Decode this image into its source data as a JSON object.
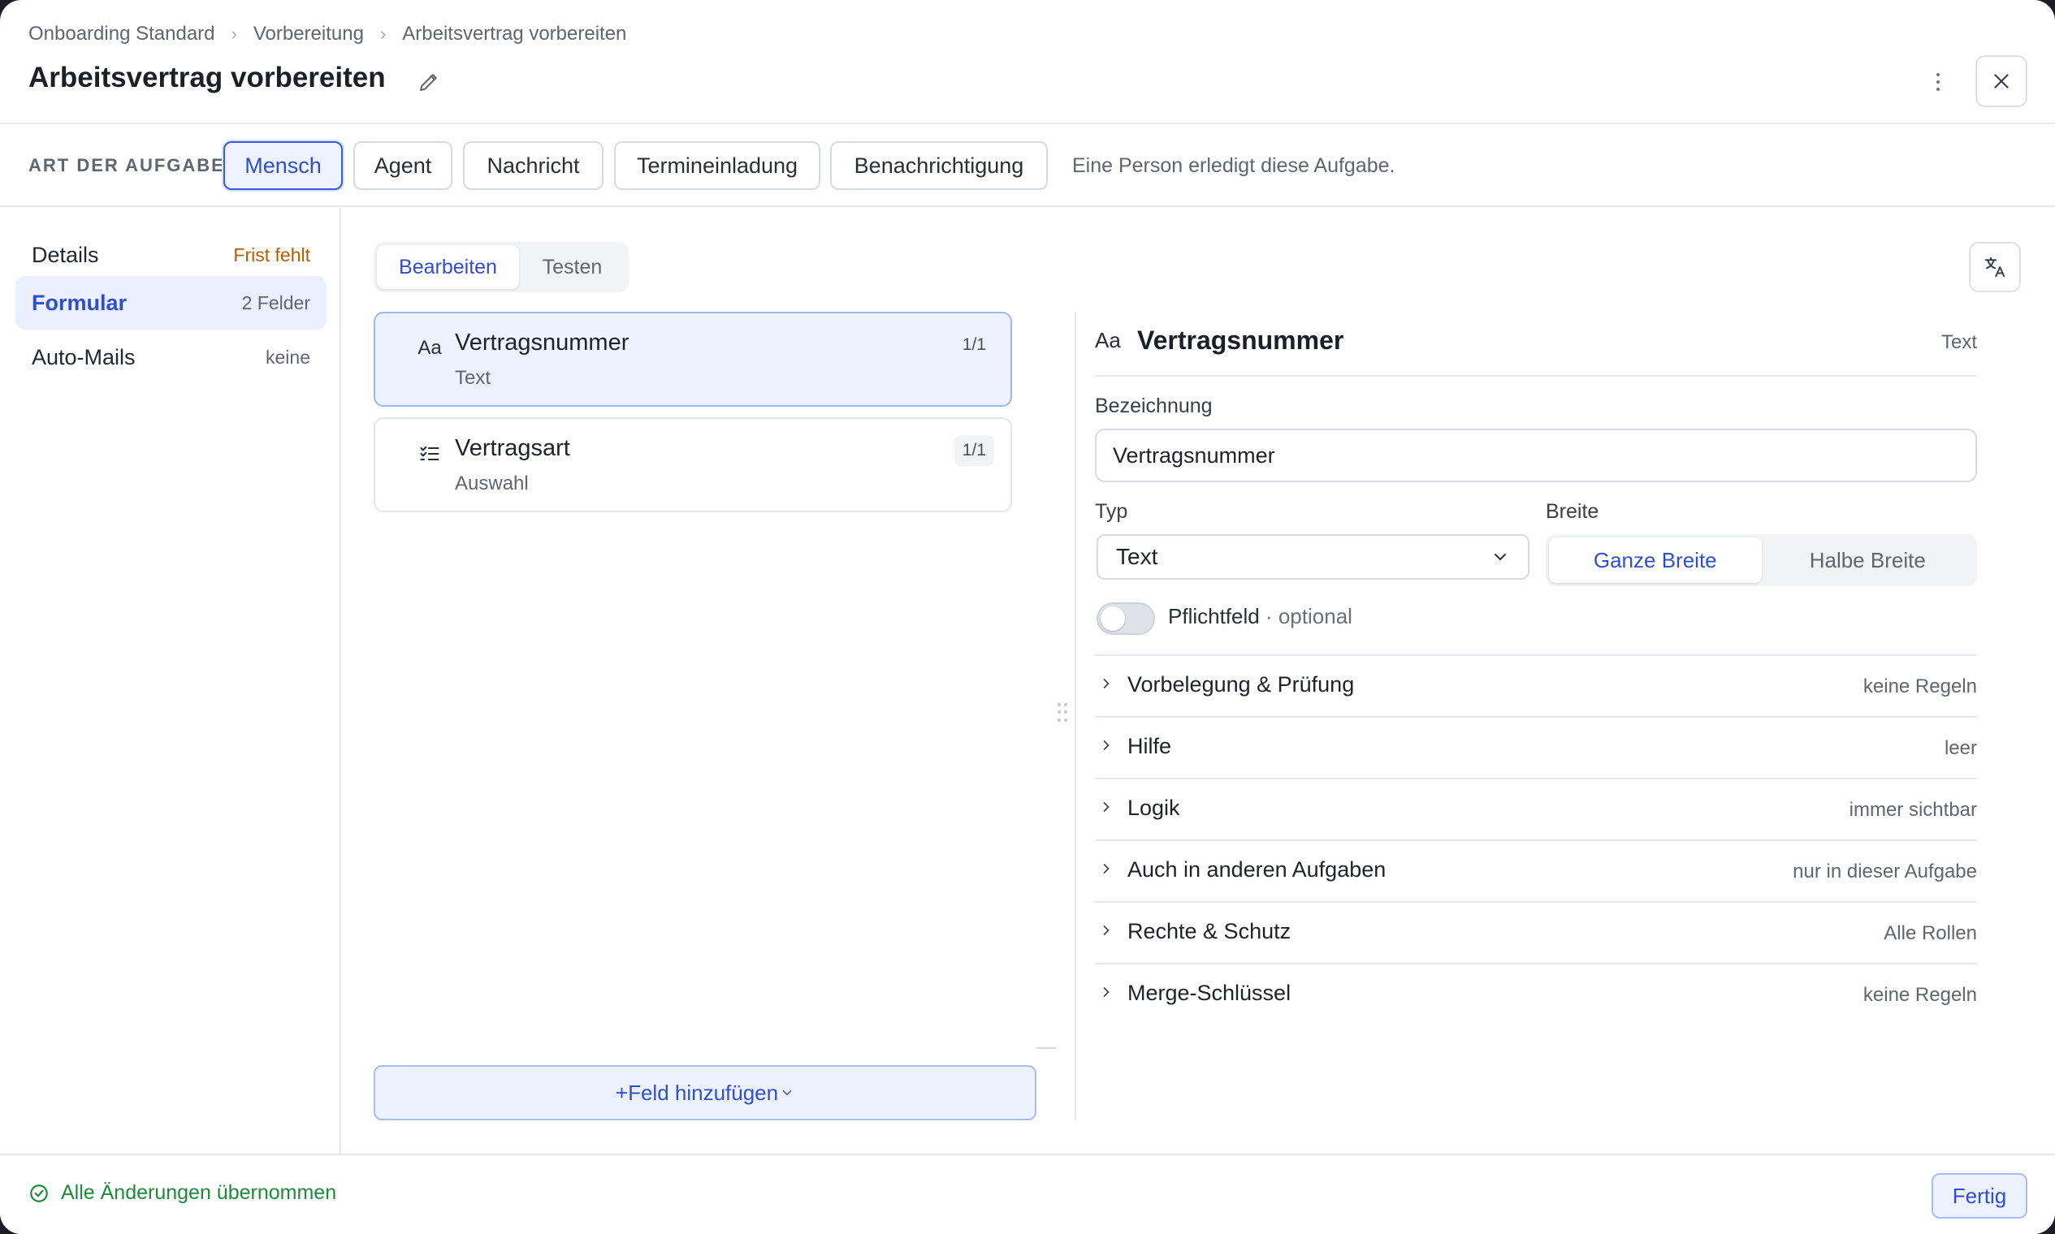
{
  "breadcrumb": [
    "Onboarding Standard",
    "Vorbereitung",
    "Arbeitsvertrag vorbereiten"
  ],
  "title": "Arbeitsvertrag vorbereiten",
  "task_type": {
    "label": "ART DER AUFGABE",
    "options": [
      "Mensch",
      "Agent",
      "Nachricht",
      "Termineinladung",
      "Benachrichtigung"
    ],
    "selected": "Mensch",
    "hint": "Eine Person erledigt diese Aufgabe."
  },
  "nav": [
    {
      "label": "Details",
      "meta": "Frist fehlt"
    },
    {
      "label": "Formular",
      "meta": "2 Felder"
    },
    {
      "label": "Auto-Mails",
      "meta": "keine"
    }
  ],
  "mode_tabs": [
    "Bearbeiten",
    "Testen"
  ],
  "fields": [
    {
      "icon": "Aa",
      "name": "Vertragsnummer",
      "type": "Text",
      "count": "1/1"
    },
    {
      "icon": "checklist",
      "name": "Vertragsart",
      "type": "Auswahl",
      "count": "1/1"
    }
  ],
  "add_field_label": "+Feld hinzufügen",
  "editor": {
    "icon": "Aa",
    "name": "Vertragsnummer",
    "type_badge": "Text",
    "label_caption": "Bezeichnung",
    "label_value": "Vertragsnummer",
    "type_caption": "Typ",
    "type_value": "Text",
    "width_caption": "Breite",
    "width_options": [
      "Ganze Breite",
      "Halbe Breite"
    ],
    "required_label": "Pflichtfeld",
    "required_state": "· optional",
    "sections": [
      {
        "title": "Vorbelegung & Prüfung",
        "value": "keine Regeln"
      },
      {
        "title": "Hilfe",
        "value": "leer"
      },
      {
        "title": "Logik",
        "value": "immer sichtbar"
      },
      {
        "title": "Auch in anderen Aufgaben",
        "value": "nur in dieser Aufgabe"
      },
      {
        "title": "Rechte & Schutz",
        "value": "Alle Rollen"
      },
      {
        "title": "Merge-Schlüssel",
        "value": "keine Regeln"
      }
    ]
  },
  "footer": {
    "status": "Alle Änderungen übernommen",
    "done_label": "Fertig"
  },
  "colors": {
    "accent": "#2f4fd0",
    "accent_bg": "#edf2ff",
    "warning": "#b85c00",
    "success": "#1f8a3b"
  }
}
